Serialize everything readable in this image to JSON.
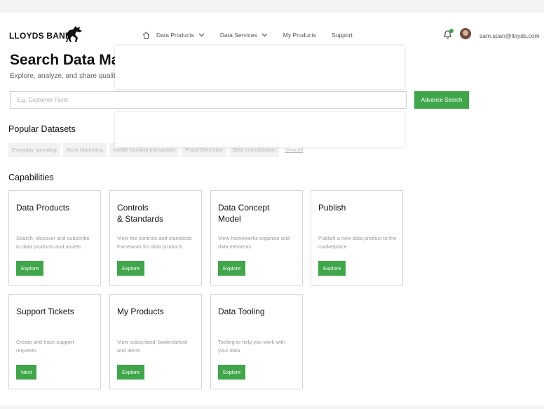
{
  "header": {
    "brand": "LLOYDS BANK",
    "nav": [
      {
        "label": "Data Products",
        "has_dropdown": true
      },
      {
        "label": "Data Services",
        "has_dropdown": true
      },
      {
        "label": "My Products",
        "has_dropdown": false
      },
      {
        "label": "Support",
        "has_dropdown": false
      }
    ],
    "user_email": "sam.span@lloyds.com"
  },
  "hero": {
    "title": "Search Data Marketplace",
    "subtitle": "Explore, analyze, and share quality data. Learn more"
  },
  "search": {
    "placeholder": "E.g. Customer Facts",
    "advance_label": "Advance Search"
  },
  "popular": {
    "heading": "Popular Datasets",
    "chips": [
      "Everyday spending",
      "Bank Marketing",
      "mobile banking transaction",
      "Fraud Detection",
      "Debt consolidation"
    ],
    "view_all": "View All"
  },
  "capabilities": {
    "heading": "Capabilities",
    "cards": [
      {
        "title": "Data Products",
        "desc": "Search, discover and subscribe to data products and assets",
        "button": "Explore"
      },
      {
        "title": "Controls\n& Standards",
        "desc": "View the controls and standards framework for data products",
        "button": "Explore"
      },
      {
        "title": "Data Concept\nModel",
        "desc": "View frameworks organise and data elements",
        "button": "Explore"
      },
      {
        "title": "Publish",
        "desc": "Publish a new data product to the marketplace",
        "button": "Explore"
      },
      {
        "title": "Support Tickets",
        "desc": "Create and track support requests",
        "button": "Next"
      },
      {
        "title": "My Products",
        "desc": "View subscribed, bookmarked and alerts",
        "button": "Explore"
      },
      {
        "title": "Data Tooling",
        "desc": "Tooling to help you work with your data",
        "button": "Explore"
      }
    ]
  },
  "colors": {
    "accent": "#3fa64a"
  },
  "icons": [
    "horse-logo-icon",
    "home-icon",
    "chevron-down-icon",
    "bell-icon",
    "avatar"
  ]
}
